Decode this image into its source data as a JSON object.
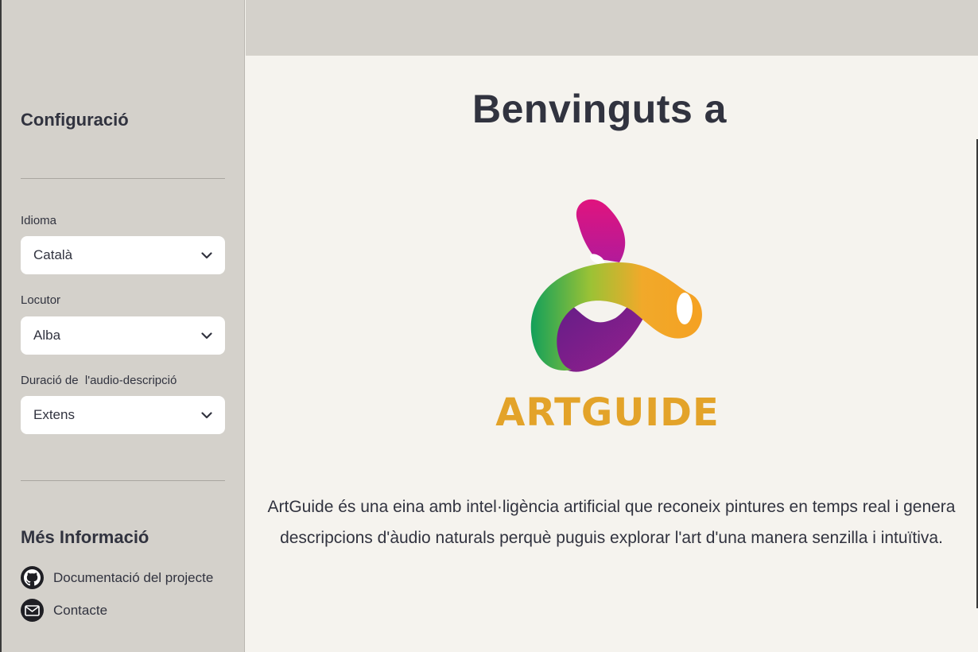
{
  "sidebar": {
    "config_title": "Configuració",
    "language": {
      "label": "Idioma",
      "value": "Català"
    },
    "speaker": {
      "label": "Locutor",
      "value": "Alba"
    },
    "duration": {
      "label": "Duració de  l'audio-descripció",
      "value": "Extens"
    },
    "info_title": "Més Informació",
    "links": {
      "docs": {
        "label": "Documentació del projecte",
        "icon": "github-icon"
      },
      "contact": {
        "label": "Contacte",
        "icon": "mail-icon"
      }
    }
  },
  "main": {
    "title": "Benvinguts a",
    "logo": {
      "text": "ARTGUIDE",
      "icon": "artguide-logo"
    },
    "description": "ArtGuide és una eina amb intel·ligència artificial que reconeix pintures en temps real i genera descripcions d'àudio naturals perquè puguis explorar l'art d'una manera senzilla i intuïtiva."
  },
  "colors": {
    "sidebar_bg": "#d4d1cb",
    "main_bg": "#f5f3ee",
    "text": "#31333f",
    "logo_text": "#e3a329"
  }
}
